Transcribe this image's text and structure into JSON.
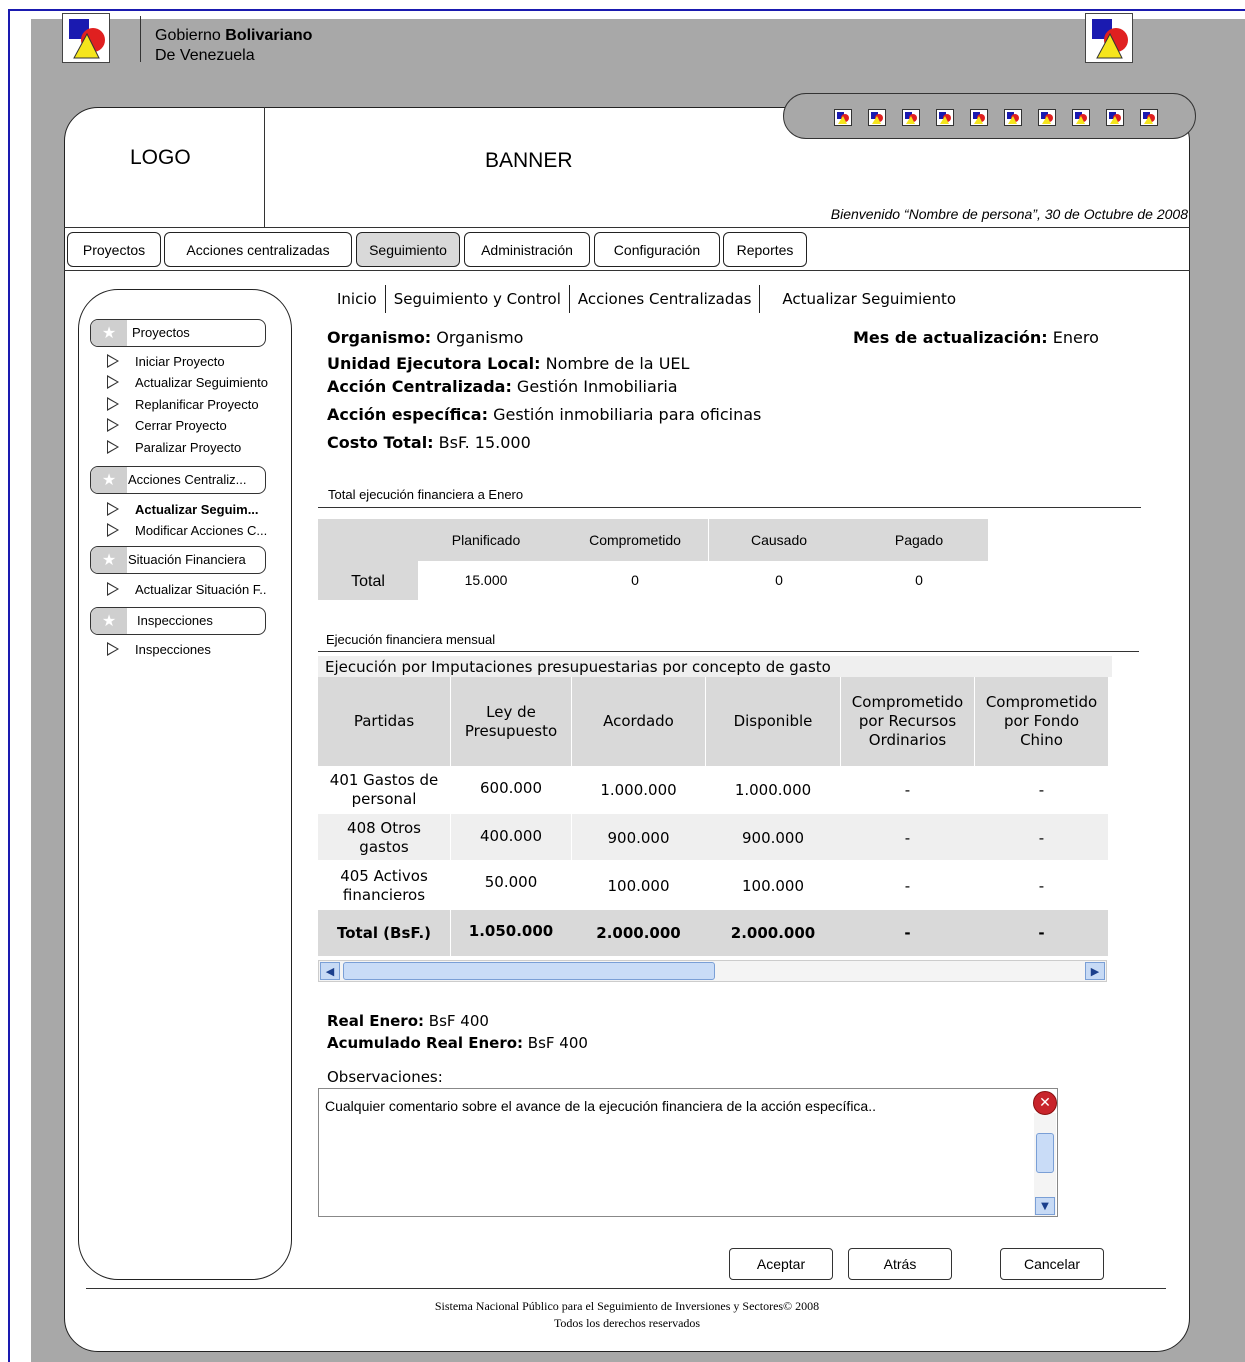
{
  "government": {
    "prefix": "Gobierno ",
    "bold": "Bolivariano",
    "line2": "De Venezuela"
  },
  "header": {
    "logo_text": "LOGO",
    "banner_text": "BANNER",
    "welcome": "Bienvenido “Nombre de persona”, 30 de Octubre de 2008",
    "toolbar_icon_count": 10
  },
  "tabs": [
    {
      "label": "Proyectos"
    },
    {
      "label": "Acciones centralizadas"
    },
    {
      "label": "Seguimiento",
      "active": true
    },
    {
      "label": "Administración"
    },
    {
      "label": "Configuración"
    },
    {
      "label": "Reportes"
    }
  ],
  "sidebar": {
    "sections": [
      {
        "title": "Proyectos",
        "items": [
          "Iniciar Proyecto",
          "Actualizar Seguimiento",
          "Replanificar Proyecto",
          "Cerrar Proyecto",
          "Paralizar Proyecto"
        ]
      },
      {
        "title": "Acciones Centraliz...",
        "items": [
          "Actualizar Seguim...",
          "Modificar Acciones C..."
        ]
      },
      {
        "title": "Situación Financiera",
        "items": [
          "Actualizar Situación F.."
        ]
      },
      {
        "title": "Inspecciones",
        "items": [
          "Inspecciones"
        ]
      }
    ]
  },
  "breadcrumb": [
    "Inicio",
    "Seguimiento y Control",
    "Acciones Centralizadas",
    "Actualizar Seguimiento"
  ],
  "info": {
    "organismo_label": "Organismo:",
    "organismo_value": " Organismo",
    "mes_label": "Mes de actualización:",
    "mes_value": " Enero",
    "uel_label": "Unidad Ejecutora Local:",
    "uel_value": " Nombre de la UEL",
    "accion_label": "Acción Centralizada:",
    "accion_value": " Gestión Inmobiliaria",
    "especifica_label": "Acción específica:",
    "especifica_value": " Gestión inmobiliaria para oficinas",
    "costo_label": "Costo Total:",
    "costo_value": " BsF. 15.000"
  },
  "total_section": {
    "title": "Total ejecución financiera a Enero",
    "headers": [
      "Planificado",
      "Comprometido",
      "Causado",
      "Pagado"
    ],
    "row_label": "Total",
    "values": [
      "15.000",
      "0",
      "0",
      "0"
    ]
  },
  "monthly_section": {
    "title": "Ejecución financiera mensual",
    "subtitle": "Ejecución por Imputaciones presupuestarias por concepto de gasto",
    "headers": [
      "Partidas",
      "Ley de Presupuesto",
      "Acordado",
      "Disponible",
      "Comprometido por Recursos Ordinarios",
      "Comprometido por Fondo Chino"
    ],
    "rows": [
      [
        "401 Gastos de personal",
        "600.000",
        "1.000.000",
        "1.000.000",
        "-",
        "-"
      ],
      [
        "408 Otros gastos",
        "400.000",
        "900.000",
        "900.000",
        "-",
        "-"
      ],
      [
        "405 Activos financieros",
        "50.000",
        "100.000",
        "100.000",
        "-",
        "-"
      ]
    ],
    "total_row": [
      "Total (BsF.)",
      "1.050.000",
      "2.000.000",
      "2.000.000",
      "-",
      "-"
    ]
  },
  "real": {
    "real_label": "Real Enero:",
    "real_value": " BsF 400",
    "acum_label": "Acumulado Real Enero:",
    "acum_value": " BsF 400"
  },
  "observaciones": {
    "label": "Observaciones:",
    "text": "Cualquier comentario sobre el avance de la ejecución financiera de la acción específica.."
  },
  "buttons": {
    "aceptar": "Aceptar",
    "atras": "Atrás",
    "cancelar": "Cancelar"
  },
  "footer": {
    "line1": "Sistema Nacional Público para el Seguimiento de Inversiones y Sectores© 2008",
    "line2": "Todos los derechos reservados"
  },
  "colors": {
    "frame_blue": "#1a1ab0",
    "panel_gray": "#a8a8a8",
    "table_header_gray": "#d9d9d9",
    "error_red": "#c8242b"
  }
}
